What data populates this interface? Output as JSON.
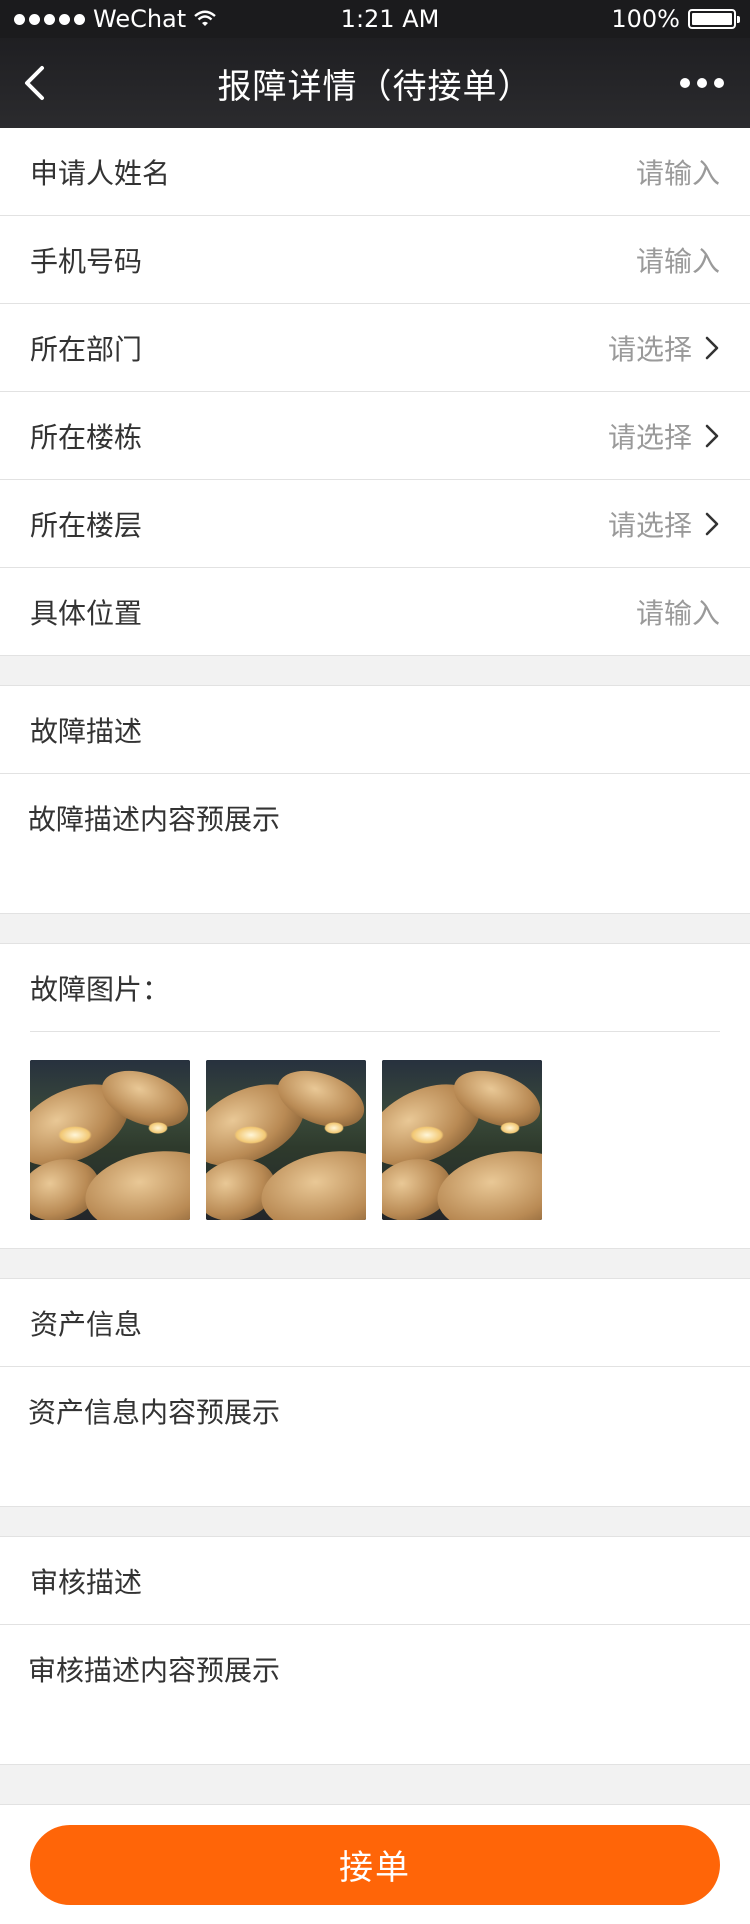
{
  "status_bar": {
    "carrier": "WeChat",
    "time": "1:21 AM",
    "battery": "100%",
    "battery_level": 1.0
  },
  "nav": {
    "title": "报障详情（待接单）"
  },
  "form": {
    "fields": [
      {
        "label": "申请人姓名",
        "value": "请输入",
        "arrow": false
      },
      {
        "label": "手机号码",
        "value": "请输入",
        "arrow": false
      },
      {
        "label": "所在部门",
        "value": "请选择",
        "arrow": true
      },
      {
        "label": "所在楼栋",
        "value": "请选择",
        "arrow": true
      },
      {
        "label": "所在楼层",
        "value": "请选择",
        "arrow": true
      },
      {
        "label": "具体位置",
        "value": "请输入",
        "arrow": false
      }
    ]
  },
  "fault_desc": {
    "title": "故障描述",
    "content": "故障描述内容预展示"
  },
  "fault_photos": {
    "title": "故障图片：",
    "count": 3
  },
  "asset_info": {
    "title": "资产信息",
    "content": "资产信息内容预展示"
  },
  "review_desc": {
    "title": "审核描述",
    "content": "审核描述内容预展示"
  },
  "actions": {
    "accept_label": "接单"
  },
  "colors": {
    "accent": "#ff6508",
    "nav_bg": "#1f1f22",
    "page_bg": "#f2f2f2"
  }
}
